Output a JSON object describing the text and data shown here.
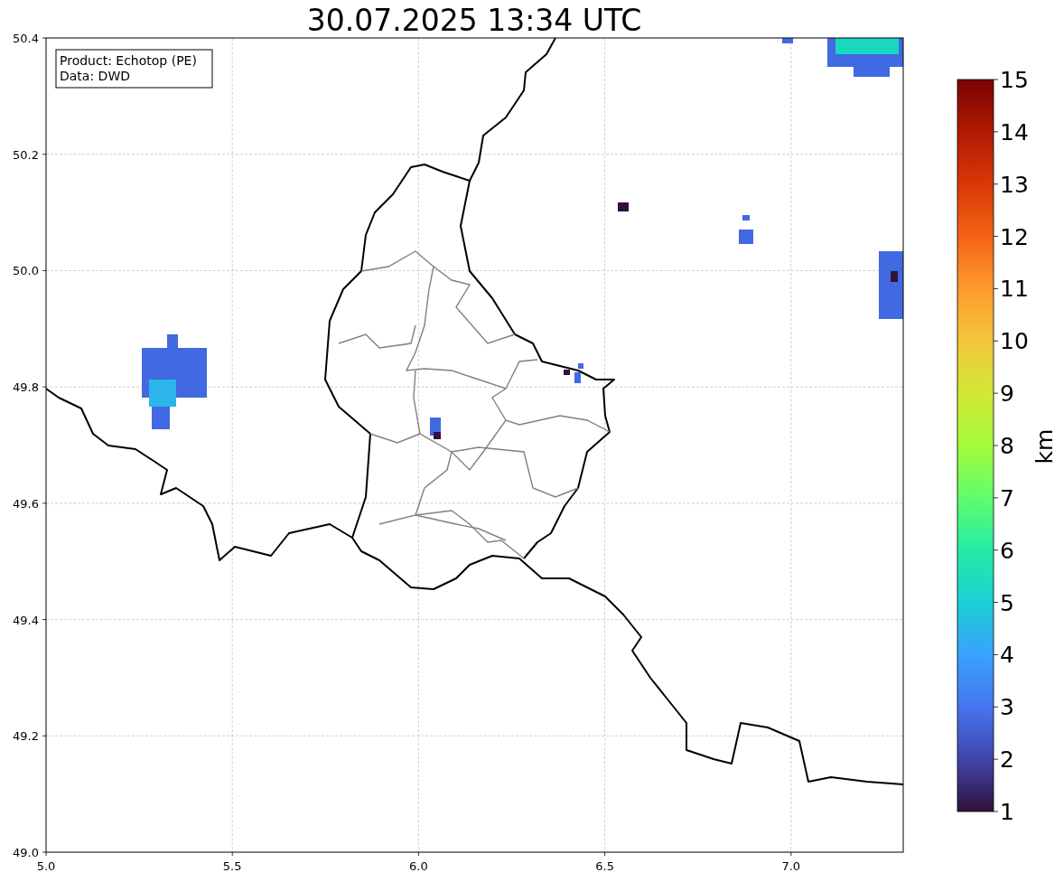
{
  "title": "30.07.2025 13:34 UTC",
  "legend": [
    "Product: Echotop (PE)",
    "Data: DWD"
  ],
  "x_ticks": [
    "5.0",
    "5.5",
    "6.0",
    "6.5",
    "7.0"
  ],
  "y_ticks": [
    "50.4",
    "50.2",
    "50.0",
    "49.8",
    "49.6",
    "49.4",
    "49.2",
    "49.0"
  ],
  "colorbar": {
    "label": "km",
    "ticks": [
      "15",
      "14",
      "13",
      "12",
      "11",
      "10",
      "9",
      "8",
      "7",
      "6",
      "5",
      "4",
      "3",
      "2",
      "1"
    ]
  }
}
